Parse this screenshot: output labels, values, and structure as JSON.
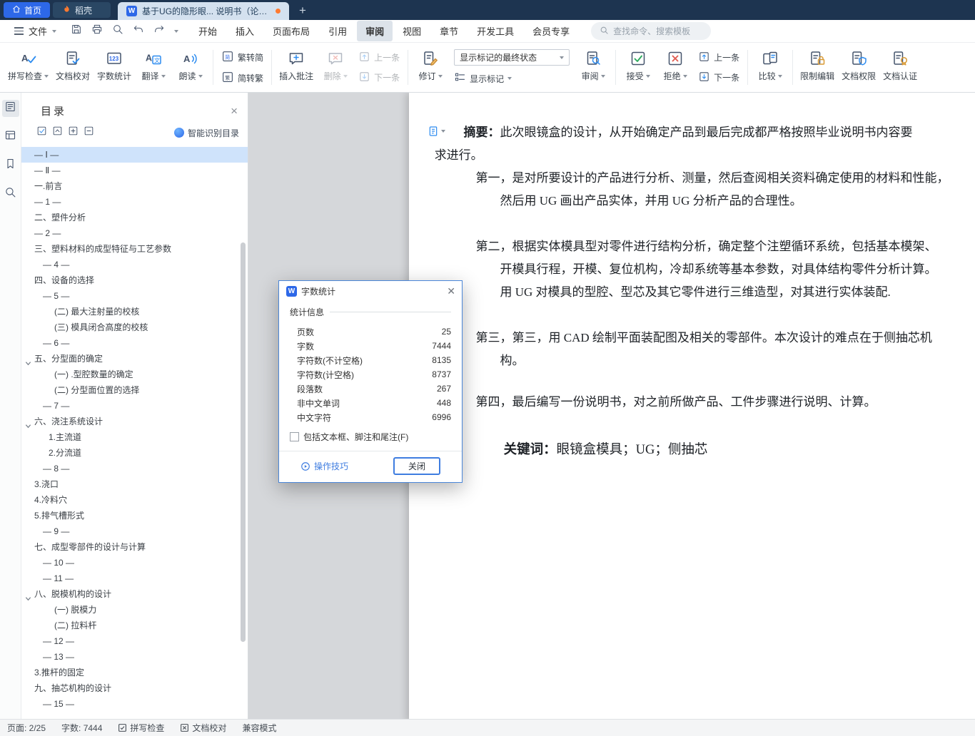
{
  "window": {
    "tabs": {
      "home": "首页",
      "docer": "稻壳",
      "document": "基于UG的隐形眼... 说明书（论文）",
      "home_icon": "home-icon",
      "docer_icon": "flame-icon",
      "document_icon": "wps-writer-icon",
      "modified_indicator": "unsaved-dot",
      "new_tab_icon": "plus-icon"
    }
  },
  "menubar": {
    "file": "文件",
    "qat_icons": [
      "save-icon",
      "print-icon",
      "print-preview-icon",
      "undo-icon",
      "redo-icon"
    ],
    "tabs": [
      "开始",
      "插入",
      "页面布局",
      "引用",
      "审阅",
      "视图",
      "章节",
      "开发工具",
      "会员专享"
    ],
    "active_tab": "审阅",
    "search_placeholder": "查找命令、搜索模板"
  },
  "ribbon": {
    "groups": [
      {
        "columns": [
          {
            "type": "big",
            "label": "拼写检查",
            "icon": "spellcheck-icon",
            "dropdown": true
          },
          {
            "type": "big",
            "label": "文档校对",
            "icon": "proofread-icon"
          },
          {
            "type": "big",
            "label": "字数统计",
            "icon": "wordcount-icon"
          },
          {
            "type": "big",
            "label": "翻译",
            "icon": "translate-icon",
            "dropdown": true
          },
          {
            "type": "big",
            "label": "朗读",
            "icon": "readaloud-icon",
            "dropdown": true
          }
        ]
      },
      {
        "columns": [
          {
            "type": "stack",
            "items": [
              {
                "label": "繁转简",
                "icon": "traditional-to-simplified-icon"
              },
              {
                "label": "简转繁",
                "icon": "simplified-to-traditional-icon"
              }
            ]
          }
        ]
      },
      {
        "columns": [
          {
            "type": "big",
            "label": "插入批注",
            "icon": "insert-comment-icon"
          },
          {
            "type": "big",
            "label": "删除",
            "icon": "delete-comment-icon",
            "dropdown": true,
            "disabled": true
          },
          {
            "type": "stack",
            "items": [
              {
                "label": "上一条",
                "icon": "prev-comment-icon",
                "disabled": true
              },
              {
                "label": "下一条",
                "icon": "next-comment-icon",
                "disabled": true
              }
            ]
          }
        ]
      },
      {
        "columns": [
          {
            "type": "big",
            "label": "修订",
            "icon": "track-changes-icon",
            "dropdown": true
          },
          {
            "type": "combo",
            "select_value": "显示标记的最终状态",
            "button": {
              "label": "显示标记",
              "icon": "show-markup-icon",
              "dropdown": true
            }
          },
          {
            "type": "big",
            "label": "审阅",
            "icon": "review-icon",
            "dropdown": true
          }
        ]
      },
      {
        "columns": [
          {
            "type": "big",
            "label": "接受",
            "icon": "accept-icon",
            "dropdown": true
          },
          {
            "type": "big",
            "label": "拒绝",
            "icon": "reject-icon",
            "dropdown": true
          },
          {
            "type": "stack",
            "items": [
              {
                "label": "上一条",
                "icon": "prev-revision-icon"
              },
              {
                "label": "下一条",
                "icon": "next-revision-icon"
              }
            ]
          }
        ]
      },
      {
        "columns": [
          {
            "type": "big",
            "label": "比较",
            "icon": "compare-icon",
            "dropdown": true
          }
        ]
      },
      {
        "columns": [
          {
            "type": "big",
            "label": "限制编辑",
            "icon": "restrict-editing-icon"
          },
          {
            "type": "big",
            "label": "文档权限",
            "icon": "doc-permission-icon"
          },
          {
            "type": "big",
            "label": "文档认证",
            "icon": "doc-certify-icon"
          }
        ]
      }
    ]
  },
  "rail_icons": [
    "catalog-panel-icon",
    "thumbnail-panel-icon",
    "bookmark-panel-icon",
    "search-panel-icon"
  ],
  "toc": {
    "title": "目录",
    "close_icon": "close-icon",
    "tool_icons": [
      "check-select-icon",
      "collapse-up-icon",
      "expand-plus-icon",
      "collapse-minus-icon"
    ],
    "smart_label": "智能识别目录",
    "smart_icon": "ai-recognize-icon",
    "items": [
      {
        "label": "— Ⅰ —",
        "level": 0,
        "selected": true
      },
      {
        "label": "— Ⅱ —",
        "level": 0
      },
      {
        "label": "一.前言",
        "level": 0
      },
      {
        "label": "— 1 —",
        "level": 0
      },
      {
        "label": "二、塑件分析",
        "level": 0
      },
      {
        "label": "— 2 —",
        "level": 0
      },
      {
        "label": "三、塑料材料的成型特征与工艺参数",
        "level": 0
      },
      {
        "label": "— 4 —",
        "level": 1
      },
      {
        "label": "四、设备的选择",
        "level": 0
      },
      {
        "label": "— 5 —",
        "level": 1
      },
      {
        "label": "(二) 最大注射量的校核",
        "level": 3
      },
      {
        "label": "(三) 模具闭合高度的校核",
        "level": 3
      },
      {
        "label": "— 6 —",
        "level": 1
      },
      {
        "label": "五、分型面的确定",
        "level": 0,
        "expandable": true
      },
      {
        "label": "(一) .型腔数量的确定",
        "level": 3
      },
      {
        "label": "(二) 分型面位置的选择",
        "level": 3
      },
      {
        "label": "— 7 —",
        "level": 1
      },
      {
        "label": "六、浇注系统设计",
        "level": 0,
        "expandable": true
      },
      {
        "label": "1.主流道",
        "level": 2
      },
      {
        "label": "2.分流道",
        "level": 2
      },
      {
        "label": "— 8 —",
        "level": 1
      },
      {
        "label": "3.浇口",
        "level": 0
      },
      {
        "label": "4.冷料穴",
        "level": 0
      },
      {
        "label": "5.排气槽形式",
        "level": 0
      },
      {
        "label": "— 9 —",
        "level": 1
      },
      {
        "label": "七、成型零部件的设计与计算",
        "level": 0
      },
      {
        "label": "— 10 —",
        "level": 1
      },
      {
        "label": "— 11 —",
        "level": 1
      },
      {
        "label": "八、脱模机构的设计",
        "level": 0,
        "expandable": true
      },
      {
        "label": "(一) 脱模力",
        "level": 3
      },
      {
        "label": "(二) 拉料杆",
        "level": 3
      },
      {
        "label": "— 12 —",
        "level": 1
      },
      {
        "label": "— 13 —",
        "level": 1
      },
      {
        "label": "3.推杆的固定",
        "level": 0
      },
      {
        "label": "九、抽芯机构的设计",
        "level": 0
      },
      {
        "label": "— 15 —",
        "level": 1
      }
    ]
  },
  "document": {
    "format_widget_icon": "paragraph-format-icon",
    "lines": [
      {
        "indent": 2.5,
        "bold": "摘要：",
        "text": "此次眼镜盒的设计，从开始确定产品到最后完成都严格按照毕业说明书内容要"
      },
      {
        "indent": 0.1,
        "text": "求进行。"
      },
      {
        "indent": 3.5,
        "text": "第一，是对所要设计的产品进行分析、测量，然后查阅相关资料确定使用的材料和性能，"
      },
      {
        "indent": 5.5,
        "text": "然后用 UG 画出产品实体，并用 UG 分析产品的合理性。"
      },
      {
        "indent": 3.5,
        "gap": 1,
        "text": "第二，根据实体模具型对零件进行结构分析，确定整个注塑循环系统，包括基本模架、"
      },
      {
        "indent": 5.5,
        "text": "开模具行程，开模、复位机构，冷却系统等基本参数，对具体结构零件分析计算。"
      },
      {
        "indent": 5.5,
        "text": "用 UG 对模具的型腔、型芯及其它零件进行三维造型，对其进行实体装配."
      },
      {
        "indent": 3.5,
        "gap": 1,
        "text": "第三，第三，用 CAD 绘制平面装配图及相关的零部件。本次设计的难点在于侧抽芯机"
      },
      {
        "indent": 5.5,
        "text": "构。"
      },
      {
        "indent": 3.5,
        "gap": 0.8,
        "text": "第四，最后编写一份说明书，对之前所做产品、工件步骤进行说明、计算。"
      },
      {
        "indent": 5.8,
        "gap": 1.1,
        "bold": "关键词：",
        "text": "眼镜盒模具；UG；侧抽芯",
        "em": true
      }
    ]
  },
  "dialog": {
    "title": "字数统计",
    "title_icon": "wps-writer-icon",
    "close_icon": "close-icon",
    "section": "统计信息",
    "rows": [
      {
        "label": "页数",
        "value": "25"
      },
      {
        "label": "字数",
        "value": "7444"
      },
      {
        "label": "字符数(不计空格)",
        "value": "8135"
      },
      {
        "label": "字符数(计空格)",
        "value": "8737"
      },
      {
        "label": "段落数",
        "value": "267"
      },
      {
        "label": "非中文单词",
        "value": "448"
      },
      {
        "label": "中文字符",
        "value": "6996"
      }
    ],
    "checkbox_label": "包括文本框、脚注和尾注(F)",
    "checkbox_checked": false,
    "tips_label": "操作技巧",
    "tips_icon": "play-circle-icon",
    "close_button": "关闭"
  },
  "statusbar": {
    "page": "页面: 2/25",
    "words": "字数: 7444",
    "spellcheck": "拼写检查",
    "proofread": "文档校对",
    "mode": "兼容模式",
    "spellcheck_icon": "spellcheck-status-icon",
    "proofread_icon": "proofread-status-icon"
  },
  "colors": {
    "titlebar": "#1d3450",
    "brand_blue": "#2d68e8",
    "selection_blue": "#cfe3fb",
    "accent_orange": "#ff7a30",
    "dialog_border": "#4a86d8"
  }
}
